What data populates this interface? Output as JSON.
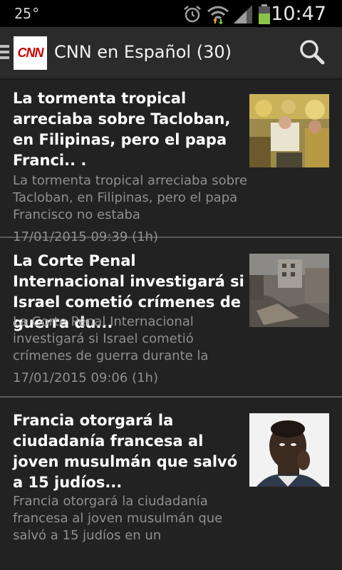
{
  "status_bar": {
    "left_text": "25°",
    "time": "10:47",
    "icons": [
      "alarm-icon",
      "wifi-icon",
      "signal-icon",
      "battery-icon"
    ],
    "battery_color": "#8bc34a"
  },
  "app_bar": {
    "logo_text": "CNN",
    "title": "CNN en Español (30)",
    "search_icon": "search-icon",
    "brand_color": "#cc0000"
  },
  "articles": [
    {
      "title": "La tormenta tropical arreciaba sobre Tacloban, en Filipinas, pero el papa Franci.. .",
      "summary": "La tormenta tropical arreciaba sobre Tacloban, en Filipinas, pero el papa Francisco no estaba",
      "date": "17/01/2015 09:39 (1h)"
    },
    {
      "title": "La Corte Penal Internacional investigará si Israel cometió crímenes de guerra du...",
      "summary": "La Corte Penal Internacional investigará si Israel cometió crímenes de guerra durante la",
      "date": "17/01/2015 09:06 (1h)"
    },
    {
      "title": "Francia otorgará la ciudadanía francesa al joven musulmán que salvó a 15 judíos...",
      "summary": "Francia otorgará la ciudadanía francesa al joven musulmán que salvó a 15 judíos en un",
      "date": ""
    }
  ]
}
